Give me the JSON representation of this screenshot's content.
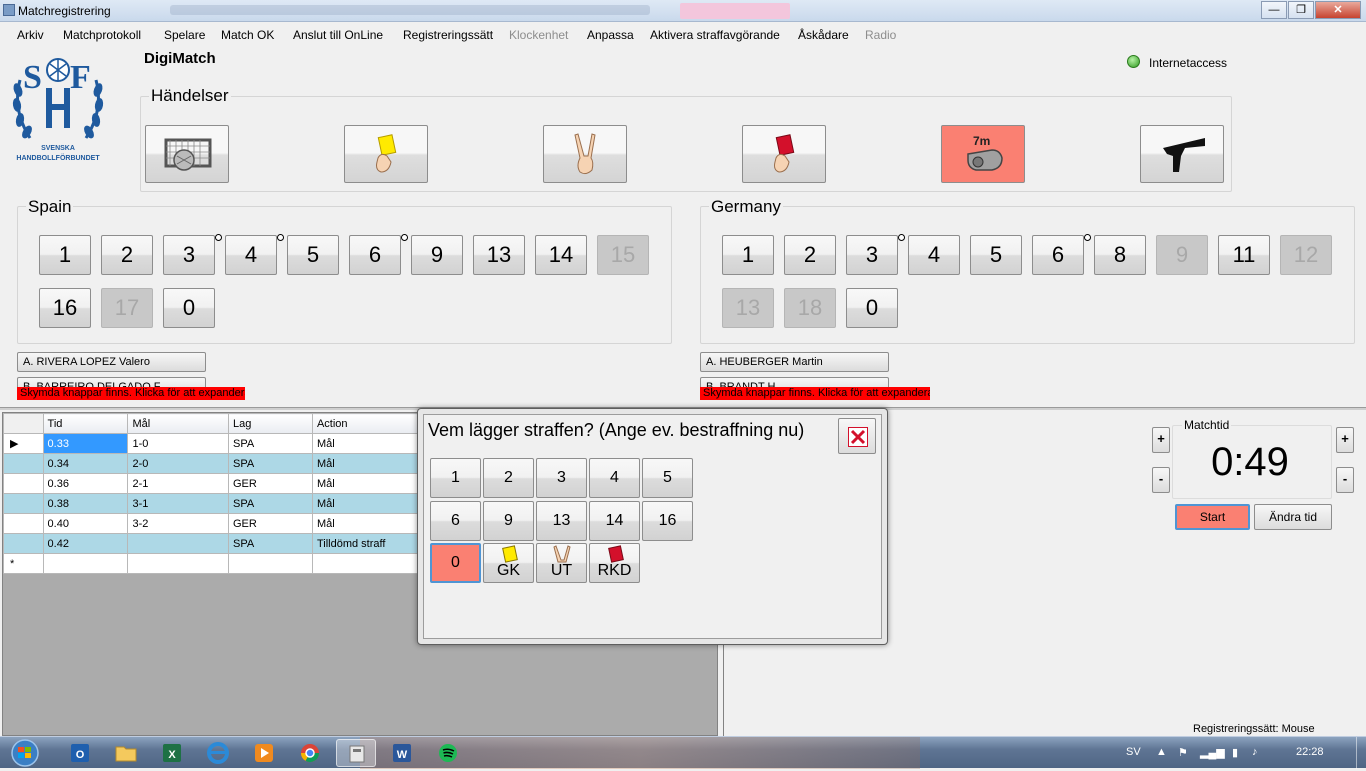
{
  "window": {
    "title": "Matchregistrering"
  },
  "menu": [
    {
      "label": "Arkiv",
      "enabled": true
    },
    {
      "label": "Matchprotokoll",
      "enabled": true
    },
    {
      "label": "Spelare",
      "enabled": true
    },
    {
      "label": "Match OK",
      "enabled": true
    },
    {
      "label": "Anslut till OnLine",
      "enabled": true
    },
    {
      "label": "Registreringssätt",
      "enabled": true
    },
    {
      "label": "Klockenhet",
      "enabled": false
    },
    {
      "label": "Anpassa",
      "enabled": true
    },
    {
      "label": "Aktivera straffavgörande",
      "enabled": true
    },
    {
      "label": "Åskådare",
      "enabled": true
    },
    {
      "label": "Radio",
      "enabled": false
    }
  ],
  "header": {
    "app_name": "DigiMatch",
    "logo_text_line1": "SVENSKA",
    "logo_text_line2": "HANDBOLLFÖRBUNDET",
    "logo_letters": "SHF",
    "internet_label": "Internetaccess",
    "internet_color": "#2f9a20"
  },
  "events": {
    "title": "Händelser",
    "buttons": [
      {
        "icon": "goal-net-icon"
      },
      {
        "icon": "yellow-card-icon"
      },
      {
        "icon": "two-minute-suspension-icon"
      },
      {
        "icon": "red-card-icon"
      },
      {
        "icon": "penalty-7m-whistle-icon",
        "highlighted": true
      },
      {
        "icon": "timeout-icon"
      }
    ]
  },
  "home": {
    "name": "Spain",
    "players": [
      {
        "num": "1",
        "active": true
      },
      {
        "num": "2",
        "active": true
      },
      {
        "num": "3",
        "active": true,
        "scored": true
      },
      {
        "num": "4",
        "active": true,
        "scored": true
      },
      {
        "num": "5",
        "active": true
      },
      {
        "num": "6",
        "active": true,
        "scored": true
      },
      {
        "num": "9",
        "active": true
      },
      {
        "num": "13",
        "active": true
      },
      {
        "num": "14",
        "active": true
      },
      {
        "num": "15",
        "active": false
      },
      {
        "num": "16",
        "active": true
      },
      {
        "num": "17",
        "active": false
      },
      {
        "num": "0",
        "active": true
      }
    ],
    "official_a": "A. RIVERA LOPEZ Valero",
    "official_b": "B. BARREIRO DELGADO F",
    "hidden_notice": "Skymda knappar finns. Klicka för att expandera"
  },
  "away": {
    "name": "Germany",
    "players": [
      {
        "num": "1",
        "active": true
      },
      {
        "num": "2",
        "active": true
      },
      {
        "num": "3",
        "active": true,
        "scored": true
      },
      {
        "num": "4",
        "active": true
      },
      {
        "num": "5",
        "active": true
      },
      {
        "num": "6",
        "active": true,
        "scored": true
      },
      {
        "num": "8",
        "active": true
      },
      {
        "num": "9",
        "active": false
      },
      {
        "num": "11",
        "active": true
      },
      {
        "num": "12",
        "active": false
      },
      {
        "num": "13",
        "active": false
      },
      {
        "num": "18",
        "active": false
      },
      {
        "num": "0",
        "active": true
      }
    ],
    "official_a": "A. HEUBERGER Martin",
    "official_b": "B. BRANDT H",
    "hidden_notice": "Skymda knappar finns. Klicka för att expandera"
  },
  "log": {
    "columns": [
      "Tid",
      "Mål",
      "Lag",
      "Action"
    ],
    "rows": [
      {
        "tid": "0.33",
        "mal": "1-0",
        "lag": "SPA",
        "action": "Mål"
      },
      {
        "tid": "0.34",
        "mal": "2-0",
        "lag": "SPA",
        "action": "Mål"
      },
      {
        "tid": "0.36",
        "mal": "2-1",
        "lag": "GER",
        "action": "Mål"
      },
      {
        "tid": "0.38",
        "mal": "3-1",
        "lag": "SPA",
        "action": "Mål"
      },
      {
        "tid": "0.40",
        "mal": "3-2",
        "lag": "GER",
        "action": "Mål"
      },
      {
        "tid": "0.42",
        "mal": "",
        "lag": "SPA",
        "action": "Tilldömd straff"
      }
    ],
    "new_row_marker": "*"
  },
  "clock": {
    "title": "Matchtid",
    "value": "0:49",
    "plus": "+",
    "minus": "-",
    "start_label": "Start",
    "change_label": "Ändra tid",
    "start_color": "#fa8072"
  },
  "status": {
    "registration_mode": "Registreringssätt: Mouse"
  },
  "dialog": {
    "question": "Vem lägger straffen? (Ange ev. bestraffning nu)",
    "numbers_row1": [
      "1",
      "2",
      "3",
      "4",
      "5"
    ],
    "numbers_row2": [
      "6",
      "9",
      "13",
      "14",
      "16"
    ],
    "zero": "0",
    "gk": "GK",
    "ut": "UT",
    "rkd": "RKD"
  },
  "taskbar": {
    "lang": "SV",
    "time": "22:28"
  }
}
